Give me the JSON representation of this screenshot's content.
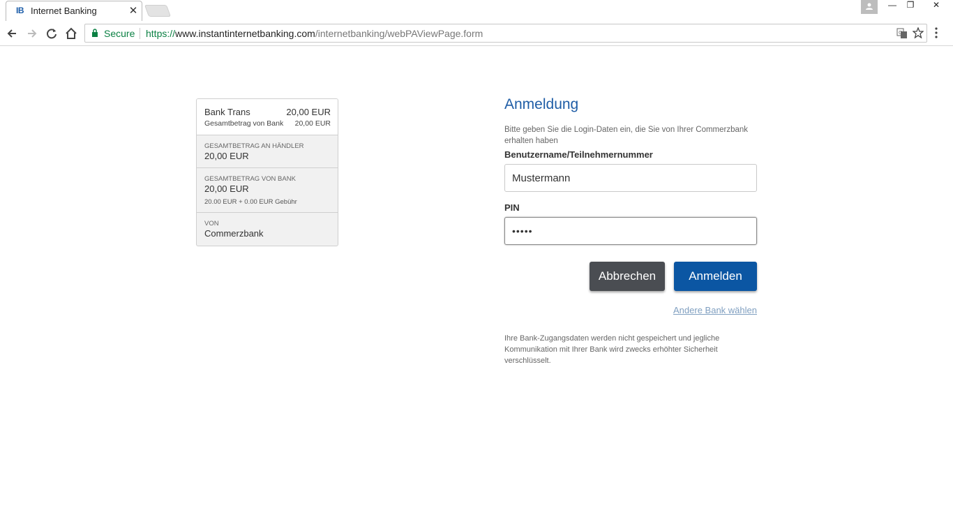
{
  "browser": {
    "tab_favicon": "IB",
    "tab_title": "Internet Banking",
    "tab_close": "✕",
    "secure_label": "Secure",
    "url_scheme": "https://",
    "url_host": "www.instantinternetbanking.com",
    "url_path": "/internetbanking/webPAViewPage.form",
    "window_min": "—",
    "window_max": "❐",
    "window_close": "✕"
  },
  "summary": {
    "merchant": "Bank Trans",
    "amount": "20,00 EUR",
    "total_label": "Gesamtbetrag von Bank",
    "total_value": "20,00 EUR",
    "to_merchant_label": "GESAMTBETRAG AN HÄNDLER",
    "to_merchant_value": "20,00 EUR",
    "from_bank_label": "GESAMTBETRAG VON BANK",
    "from_bank_value": "20,00 EUR",
    "fee_breakdown": "20.00 EUR + 0.00 EUR Gebühr",
    "from_label": "VON",
    "from_value": "Commerzbank"
  },
  "login": {
    "title": "Anmeldung",
    "intro": "Bitte geben Sie die Login-Daten ein, die Sie von Ihrer Commerzbank erhalten haben",
    "username_label": "Benutzername/Teilnehmernummer",
    "username_value": "Mustermann",
    "pin_label": "PIN",
    "pin_value": "•••••",
    "cancel_label": "Abbrechen",
    "submit_label": "Anmelden",
    "other_bank_link": "Andere Bank wählen",
    "disclaimer": "Ihre Bank-Zugangsdaten werden nicht gespeichert und jegliche Kommunikation mit Ihrer Bank wird zwecks erhöhter Sicherheit verschlüsselt."
  },
  "colors": {
    "brand_blue": "#0b56a3",
    "title_blue": "#1f5da6",
    "cancel_gray": "#4a4d52",
    "secure_green": "#0b8043"
  },
  "icons": [
    "back-arrow-icon",
    "forward-arrow-icon",
    "reload-icon",
    "home-icon",
    "lock-icon",
    "translate-icon",
    "star-icon",
    "menu-icon",
    "profile-icon"
  ]
}
